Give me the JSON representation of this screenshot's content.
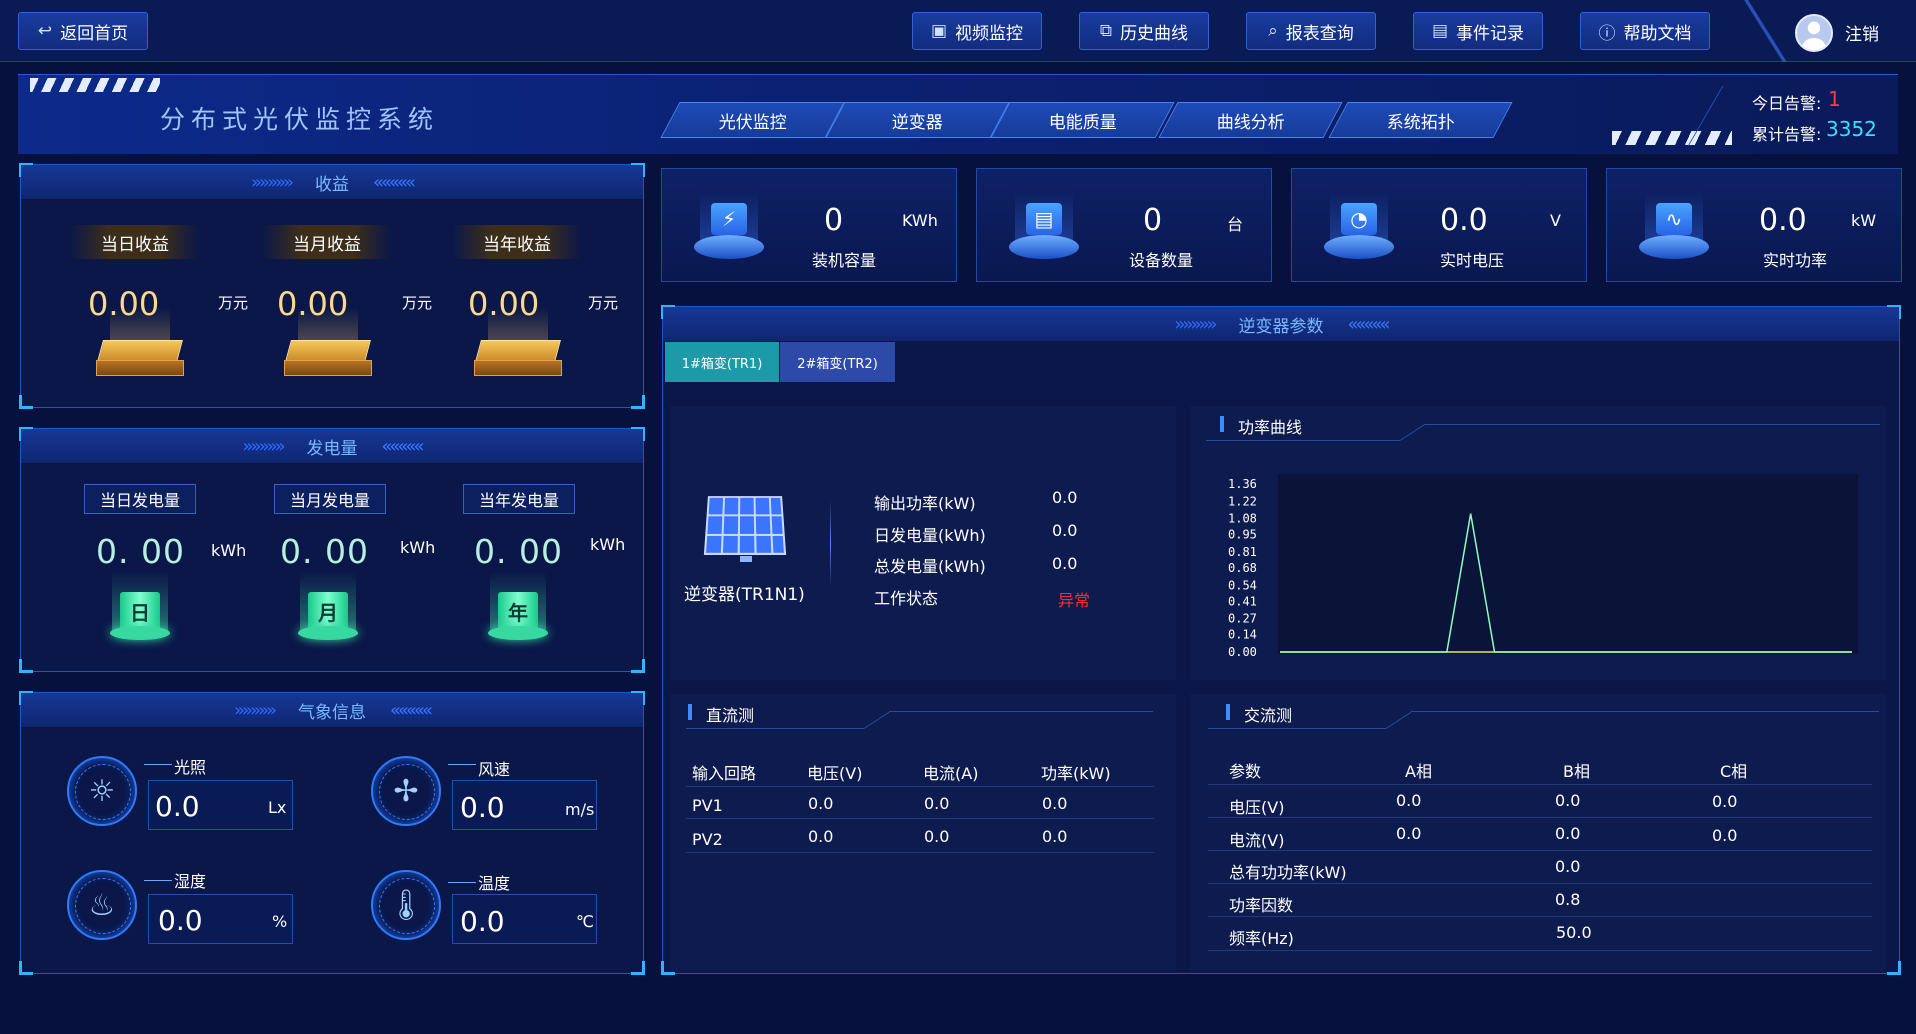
{
  "topbar": {
    "back_label": "返回首页",
    "buttons": [
      {
        "label": "视频监控",
        "icon": "video-icon"
      },
      {
        "label": "历史曲线",
        "icon": "line-chart-icon"
      },
      {
        "label": "报表查询",
        "icon": "search-report-icon"
      },
      {
        "label": "事件记录",
        "icon": "document-icon"
      },
      {
        "label": "帮助文档",
        "icon": "help-icon"
      }
    ],
    "logout_label": "注销"
  },
  "header": {
    "title": "分布式光伏监控系统",
    "tabs": [
      "光伏监控",
      "逆变器",
      "电能质量",
      "曲线分析",
      "系统拓扑"
    ],
    "alarms": {
      "today_label": "今日告警:",
      "today_value": "1",
      "total_label": "累计告警:",
      "total_value": "3352"
    }
  },
  "revenue": {
    "title": "收益",
    "items": [
      {
        "label": "当日收益",
        "value": "0.00",
        "unit": "万元"
      },
      {
        "label": "当月收益",
        "value": "0.00",
        "unit": "万元"
      },
      {
        "label": "当年收益",
        "value": "0.00",
        "unit": "万元"
      }
    ]
  },
  "generation": {
    "title": "发电量",
    "items": [
      {
        "label": "当日发电量",
        "value": "0. 00",
        "unit": "kWh",
        "glyph": "日"
      },
      {
        "label": "当月发电量",
        "value": "0. 00",
        "unit": "kWh",
        "glyph": "月"
      },
      {
        "label": "当年发电量",
        "value": "0. 00",
        "unit": "kWh",
        "glyph": "年"
      }
    ]
  },
  "weather": {
    "title": "气象信息",
    "items": [
      {
        "label": "光照",
        "value": "0.0",
        "unit": "Lx",
        "icon": "sun-icon"
      },
      {
        "label": "风速",
        "value": "0.0",
        "unit": "m/s",
        "icon": "fan-icon"
      },
      {
        "label": "湿度",
        "value": "0.0",
        "unit": "%",
        "icon": "humidity-icon"
      },
      {
        "label": "温度",
        "value": "0.0",
        "unit": "℃",
        "icon": "thermometer-icon"
      }
    ]
  },
  "stats": [
    {
      "value": "0",
      "unit": "KWh",
      "label": "装机容量",
      "icon": "battery-icon"
    },
    {
      "value": "0",
      "unit": "台",
      "label": "设备数量",
      "icon": "device-icon"
    },
    {
      "value": "0.0",
      "unit": "V",
      "label": "实时电压",
      "icon": "gauge-icon"
    },
    {
      "value": "0.0",
      "unit": "kW",
      "label": "实时功率",
      "icon": "pulse-icon"
    }
  ],
  "inverter": {
    "title": "逆变器参数",
    "tabs": [
      "1#箱变(TR1)",
      "2#箱变(TR2)"
    ],
    "device_name": "逆变器(TR1N1)",
    "params": [
      {
        "label": "输出功率(kW)",
        "value": "0.0"
      },
      {
        "label": "日发电量(kWh)",
        "value": "0.0"
      },
      {
        "label": "总发电量(kWh)",
        "value": "0.0"
      },
      {
        "label": "工作状态",
        "value": "异常"
      }
    ],
    "power_curve_title": "功率曲线",
    "dc": {
      "title": "直流测",
      "headers": [
        "输入回路",
        "电压(V)",
        "电流(A)",
        "功率(kW)"
      ],
      "rows": [
        [
          "PV1",
          "0.0",
          "0.0",
          "0.0"
        ],
        [
          "PV2",
          "0.0",
          "0.0",
          "0.0"
        ]
      ]
    },
    "ac": {
      "title": "交流测",
      "headers": [
        "参数",
        "A相",
        "B相",
        "C相"
      ],
      "rows": [
        [
          "电压(V)",
          "0.0",
          "0.0",
          "0.0"
        ],
        [
          "电流(V)",
          "0.0",
          "0.0",
          "0.0"
        ],
        [
          "总有功功率(kW)",
          "",
          "0.0",
          ""
        ],
        [
          "功率因数",
          "",
          "0.8",
          ""
        ],
        [
          "频率(Hz)",
          "",
          "50.0",
          ""
        ]
      ]
    }
  },
  "colors": {
    "background": "#07113d",
    "accent": "#2f62d6",
    "alarm_red": "#ff3b3b",
    "alarm_cyan": "#36e0ff",
    "status_abnormal": "#ff2a2a",
    "curve_green": "#8cffc0",
    "curve_yellow": "#e8e85a"
  },
  "chart_data": {
    "type": "line",
    "title": "功率曲线",
    "y_ticks": [
      "1.36",
      "1.22",
      "1.08",
      "0.95",
      "0.81",
      "0.68",
      "0.54",
      "0.41",
      "0.27",
      "0.14",
      "0.00"
    ],
    "ylim": [
      0,
      1.36
    ],
    "x": [
      0,
      1,
      2,
      3,
      4,
      5,
      6,
      7,
      8,
      9,
      10,
      11,
      12,
      13,
      14,
      15,
      16,
      17,
      18,
      19,
      20,
      21,
      22,
      23,
      24
    ],
    "series": [
      {
        "values": [
          0,
          0,
          0,
          0,
          0,
          0,
          0,
          0,
          0,
          0,
          0,
          0,
          0,
          0,
          0,
          0,
          0,
          0,
          0,
          0,
          0,
          0,
          0,
          0,
          0
        ]
      },
      {
        "values": [
          0,
          0,
          0,
          0,
          0,
          0,
          0,
          0,
          1.12,
          0,
          0,
          0,
          0,
          0,
          0,
          0,
          0,
          0,
          0,
          0,
          0,
          0,
          0,
          0,
          0
        ]
      }
    ],
    "grid": false
  }
}
